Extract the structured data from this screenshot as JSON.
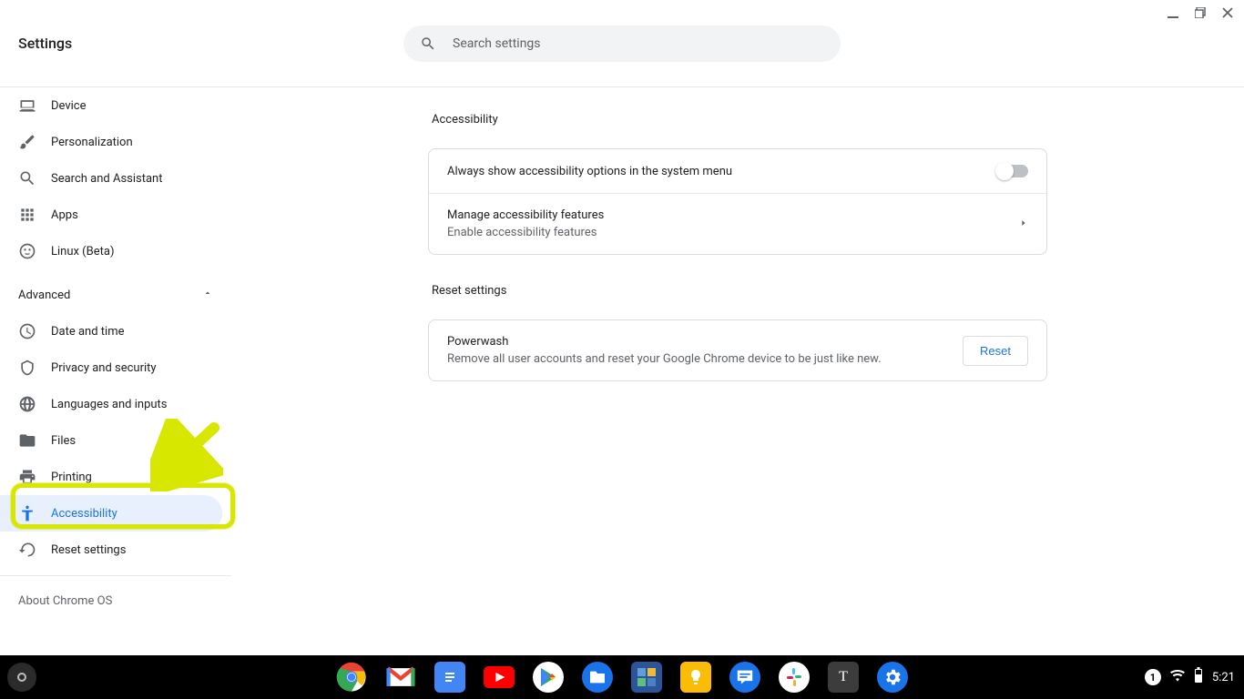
{
  "window": {
    "title": "Settings"
  },
  "search": {
    "placeholder": "Search settings"
  },
  "sidebar": {
    "top_items": [
      {
        "id": "device",
        "label": "Device"
      },
      {
        "id": "personalization",
        "label": "Personalization"
      },
      {
        "id": "search-assistant",
        "label": "Search and Assistant"
      },
      {
        "id": "apps",
        "label": "Apps"
      },
      {
        "id": "linux",
        "label": "Linux (Beta)"
      }
    ],
    "advanced_label": "Advanced",
    "advanced_items": [
      {
        "id": "date-time",
        "label": "Date and time"
      },
      {
        "id": "privacy-security",
        "label": "Privacy and security"
      },
      {
        "id": "languages-inputs",
        "label": "Languages and inputs"
      },
      {
        "id": "files",
        "label": "Files"
      },
      {
        "id": "printing",
        "label": "Printing"
      },
      {
        "id": "accessibility",
        "label": "Accessibility",
        "selected": true
      },
      {
        "id": "reset-settings",
        "label": "Reset settings"
      }
    ],
    "about_label": "About Chrome OS"
  },
  "main": {
    "accessibility": {
      "title": "Accessibility",
      "toggle_row": {
        "label": "Always show accessibility options in the system menu",
        "on": false
      },
      "manage_row": {
        "label": "Manage accessibility features",
        "sub": "Enable accessibility features"
      }
    },
    "reset": {
      "title": "Reset settings",
      "powerwash": {
        "label": "Powerwash",
        "sub": "Remove all user accounts and reset your Google Chrome device to be just like new.",
        "button": "Reset"
      }
    }
  },
  "shelf": {
    "apps": [
      {
        "id": "chrome",
        "name": "Chrome"
      },
      {
        "id": "gmail",
        "name": "Gmail"
      },
      {
        "id": "docs",
        "name": "Docs"
      },
      {
        "id": "youtube",
        "name": "YouTube"
      },
      {
        "id": "play",
        "name": "Play Store"
      },
      {
        "id": "files",
        "name": "Files"
      },
      {
        "id": "calculator",
        "name": "Calculator"
      },
      {
        "id": "keep",
        "name": "Keep"
      },
      {
        "id": "messages",
        "name": "Messages"
      },
      {
        "id": "slack",
        "name": "Slack"
      },
      {
        "id": "terminal",
        "name": "Terminal"
      },
      {
        "id": "settings",
        "name": "Settings"
      }
    ],
    "status": {
      "notification_count": "1",
      "time": "5:21"
    }
  },
  "colors": {
    "accent": "#1a73e8",
    "highlight": "#d8e700"
  }
}
